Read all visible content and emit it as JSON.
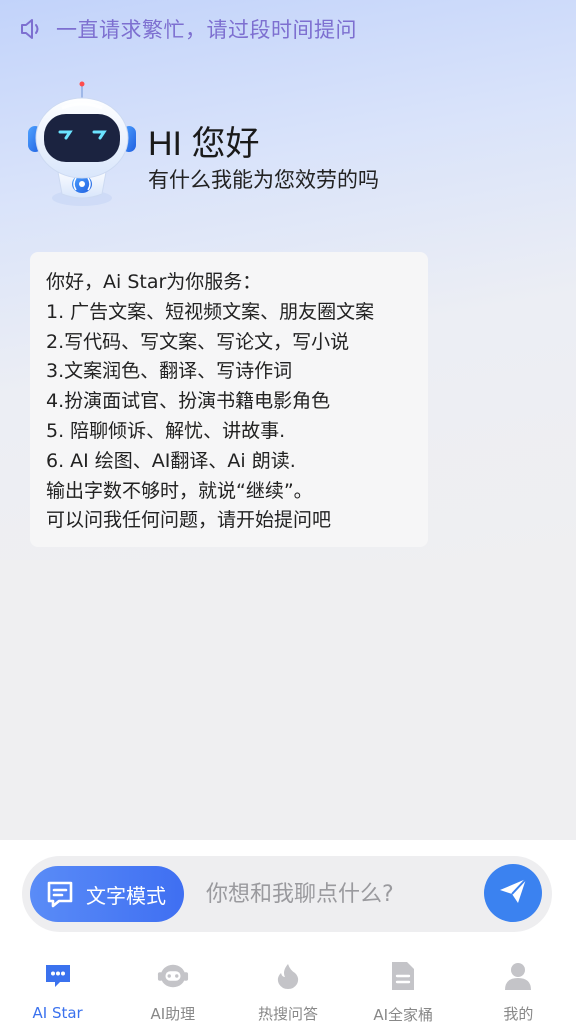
{
  "notice": {
    "icon": "speaker-icon",
    "text": "一直请求繁忙，请过段时间提问"
  },
  "greeting": {
    "title": "HI 您好",
    "subtitle": "有什么我能为您效劳的吗"
  },
  "bubble": {
    "lines": [
      "你好，Ai Star为你服务：",
      "1. 广告文案、短视频文案、朋友圈文案",
      "2.写代码、写文案、写论文，写小说",
      "3.文案润色、翻译、写诗作词",
      "4.扮演面试官、扮演书籍电影角色",
      "5. 陪聊倾诉、解忧、讲故事.",
      "6. AI 绘图、AI翻译、Ai 朗读.",
      "输出字数不够时，就说“继续”。",
      "可以问我任何问题，请开始提问吧"
    ]
  },
  "composer": {
    "mode_label": "文字模式",
    "placeholder": "你想和我聊点什么?",
    "value": ""
  },
  "tabs": [
    {
      "label": "AI Star",
      "icon": "chat-bubble-icon",
      "active": true
    },
    {
      "label": "AI助理",
      "icon": "robot-icon",
      "active": false
    },
    {
      "label": "热搜问答",
      "icon": "flame-icon",
      "active": false
    },
    {
      "label": "AI全家桶",
      "icon": "document-icon",
      "active": false
    },
    {
      "label": "我的",
      "icon": "person-icon",
      "active": false
    }
  ],
  "colors": {
    "accent": "#3b72ee",
    "notice_text": "#7d6fd0",
    "send_button": "#3b82f0"
  }
}
